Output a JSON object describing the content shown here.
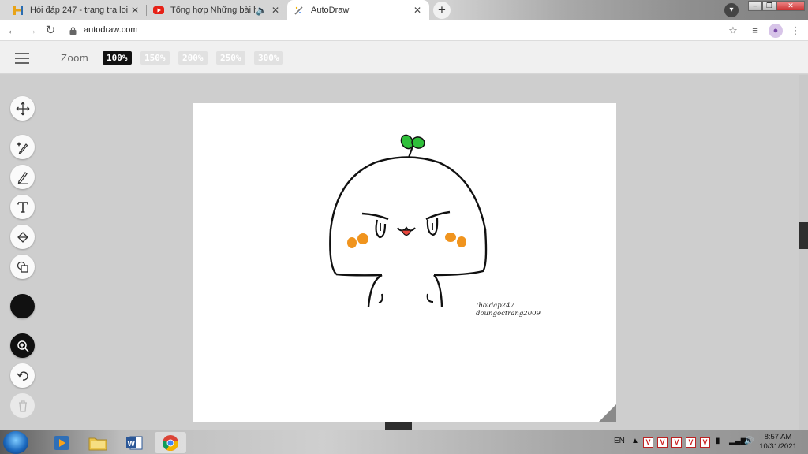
{
  "browser": {
    "tabs": [
      {
        "title": "Hỏi đáp 247 - trang tra loi",
        "favicon": "hoidap-icon"
      },
      {
        "title": "Tổng hợp Những bài hát tru",
        "favicon": "youtube-icon"
      },
      {
        "title": "AutoDraw",
        "favicon": "autodraw-icon",
        "active": true
      }
    ],
    "new_tab_label": "+",
    "url": "autodraw.com"
  },
  "autodraw": {
    "zoom_label": "Zoom",
    "zoom_options": [
      "100%",
      "150%",
      "200%",
      "250%",
      "300%"
    ],
    "zoom_selected": "100%",
    "tools": [
      "select-move",
      "autodraw",
      "draw",
      "type",
      "fill",
      "shape",
      "color",
      "zoom",
      "undo",
      "delete"
    ],
    "color_selected": "#111111",
    "credit_lines": [
      "!hoidap247",
      "doungoctrang2009"
    ]
  },
  "taskbar": {
    "apps": [
      "media-player",
      "file-explorer",
      "word",
      "chrome"
    ],
    "language": "EN",
    "time": "8:57 AM",
    "date": "10/31/2021"
  },
  "colors": {
    "zoom_active": "#111111",
    "sprout": "#2fbf3a",
    "cheeks": "#f0941e",
    "tongue": "#e8463c"
  }
}
